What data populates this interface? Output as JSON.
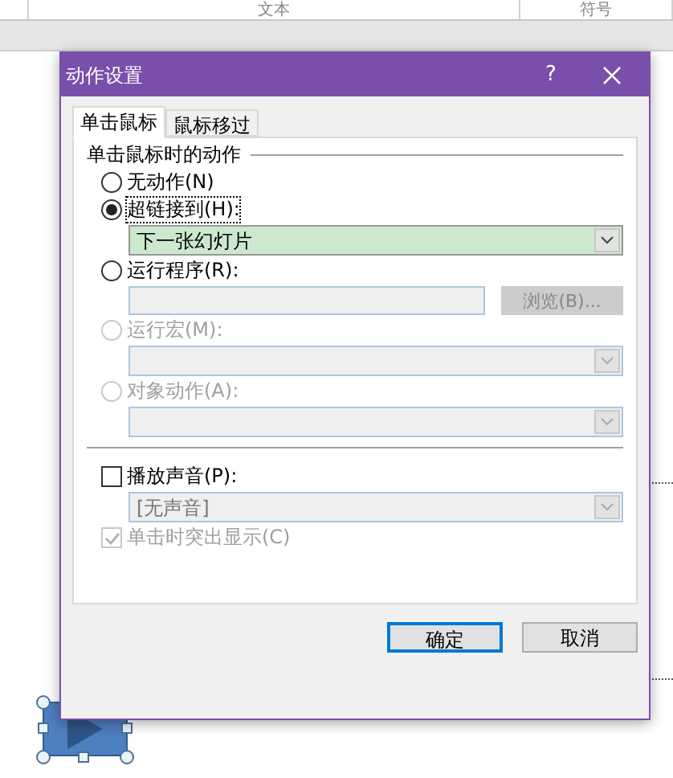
{
  "ribbon": {
    "columns": [
      "文本",
      "符号"
    ]
  },
  "dialog": {
    "title": "动作设置",
    "help": "?",
    "tabs": [
      {
        "label": "单击鼠标",
        "selected": true
      },
      {
        "label": "鼠标移过",
        "selected": false
      }
    ],
    "group_title": "单击鼠标时的动作",
    "options": [
      {
        "label": "无动作(N)",
        "selected": false,
        "disabled": false
      },
      {
        "label": "超链接到(H):",
        "selected": true,
        "disabled": false,
        "control": {
          "kind": "dropdown",
          "value": "下一张幻灯片",
          "disabled": false
        }
      },
      {
        "label": "运行程序(R):",
        "selected": false,
        "disabled": false,
        "control": {
          "kind": "text_input",
          "browse": "浏览(B)...",
          "disabled": true
        }
      },
      {
        "label": "运行宏(M):",
        "selected": false,
        "disabled": true,
        "control": {
          "kind": "dropdown",
          "disabled": true
        }
      },
      {
        "label": "对象动作(A):",
        "selected": false,
        "disabled": true,
        "control": {
          "kind": "dropdown",
          "disabled": true
        }
      }
    ],
    "sound": {
      "label": "播放声音(P):",
      "checked": false,
      "disabled": false,
      "dropdown": {
        "value": "[无声音]",
        "disabled": true
      }
    },
    "highlight": {
      "label": "单击时突出显示(C)",
      "checked": true,
      "disabled": true
    },
    "buttons": [
      {
        "label": "确定",
        "default": true
      },
      {
        "label": "取消",
        "default": false
      }
    ]
  }
}
